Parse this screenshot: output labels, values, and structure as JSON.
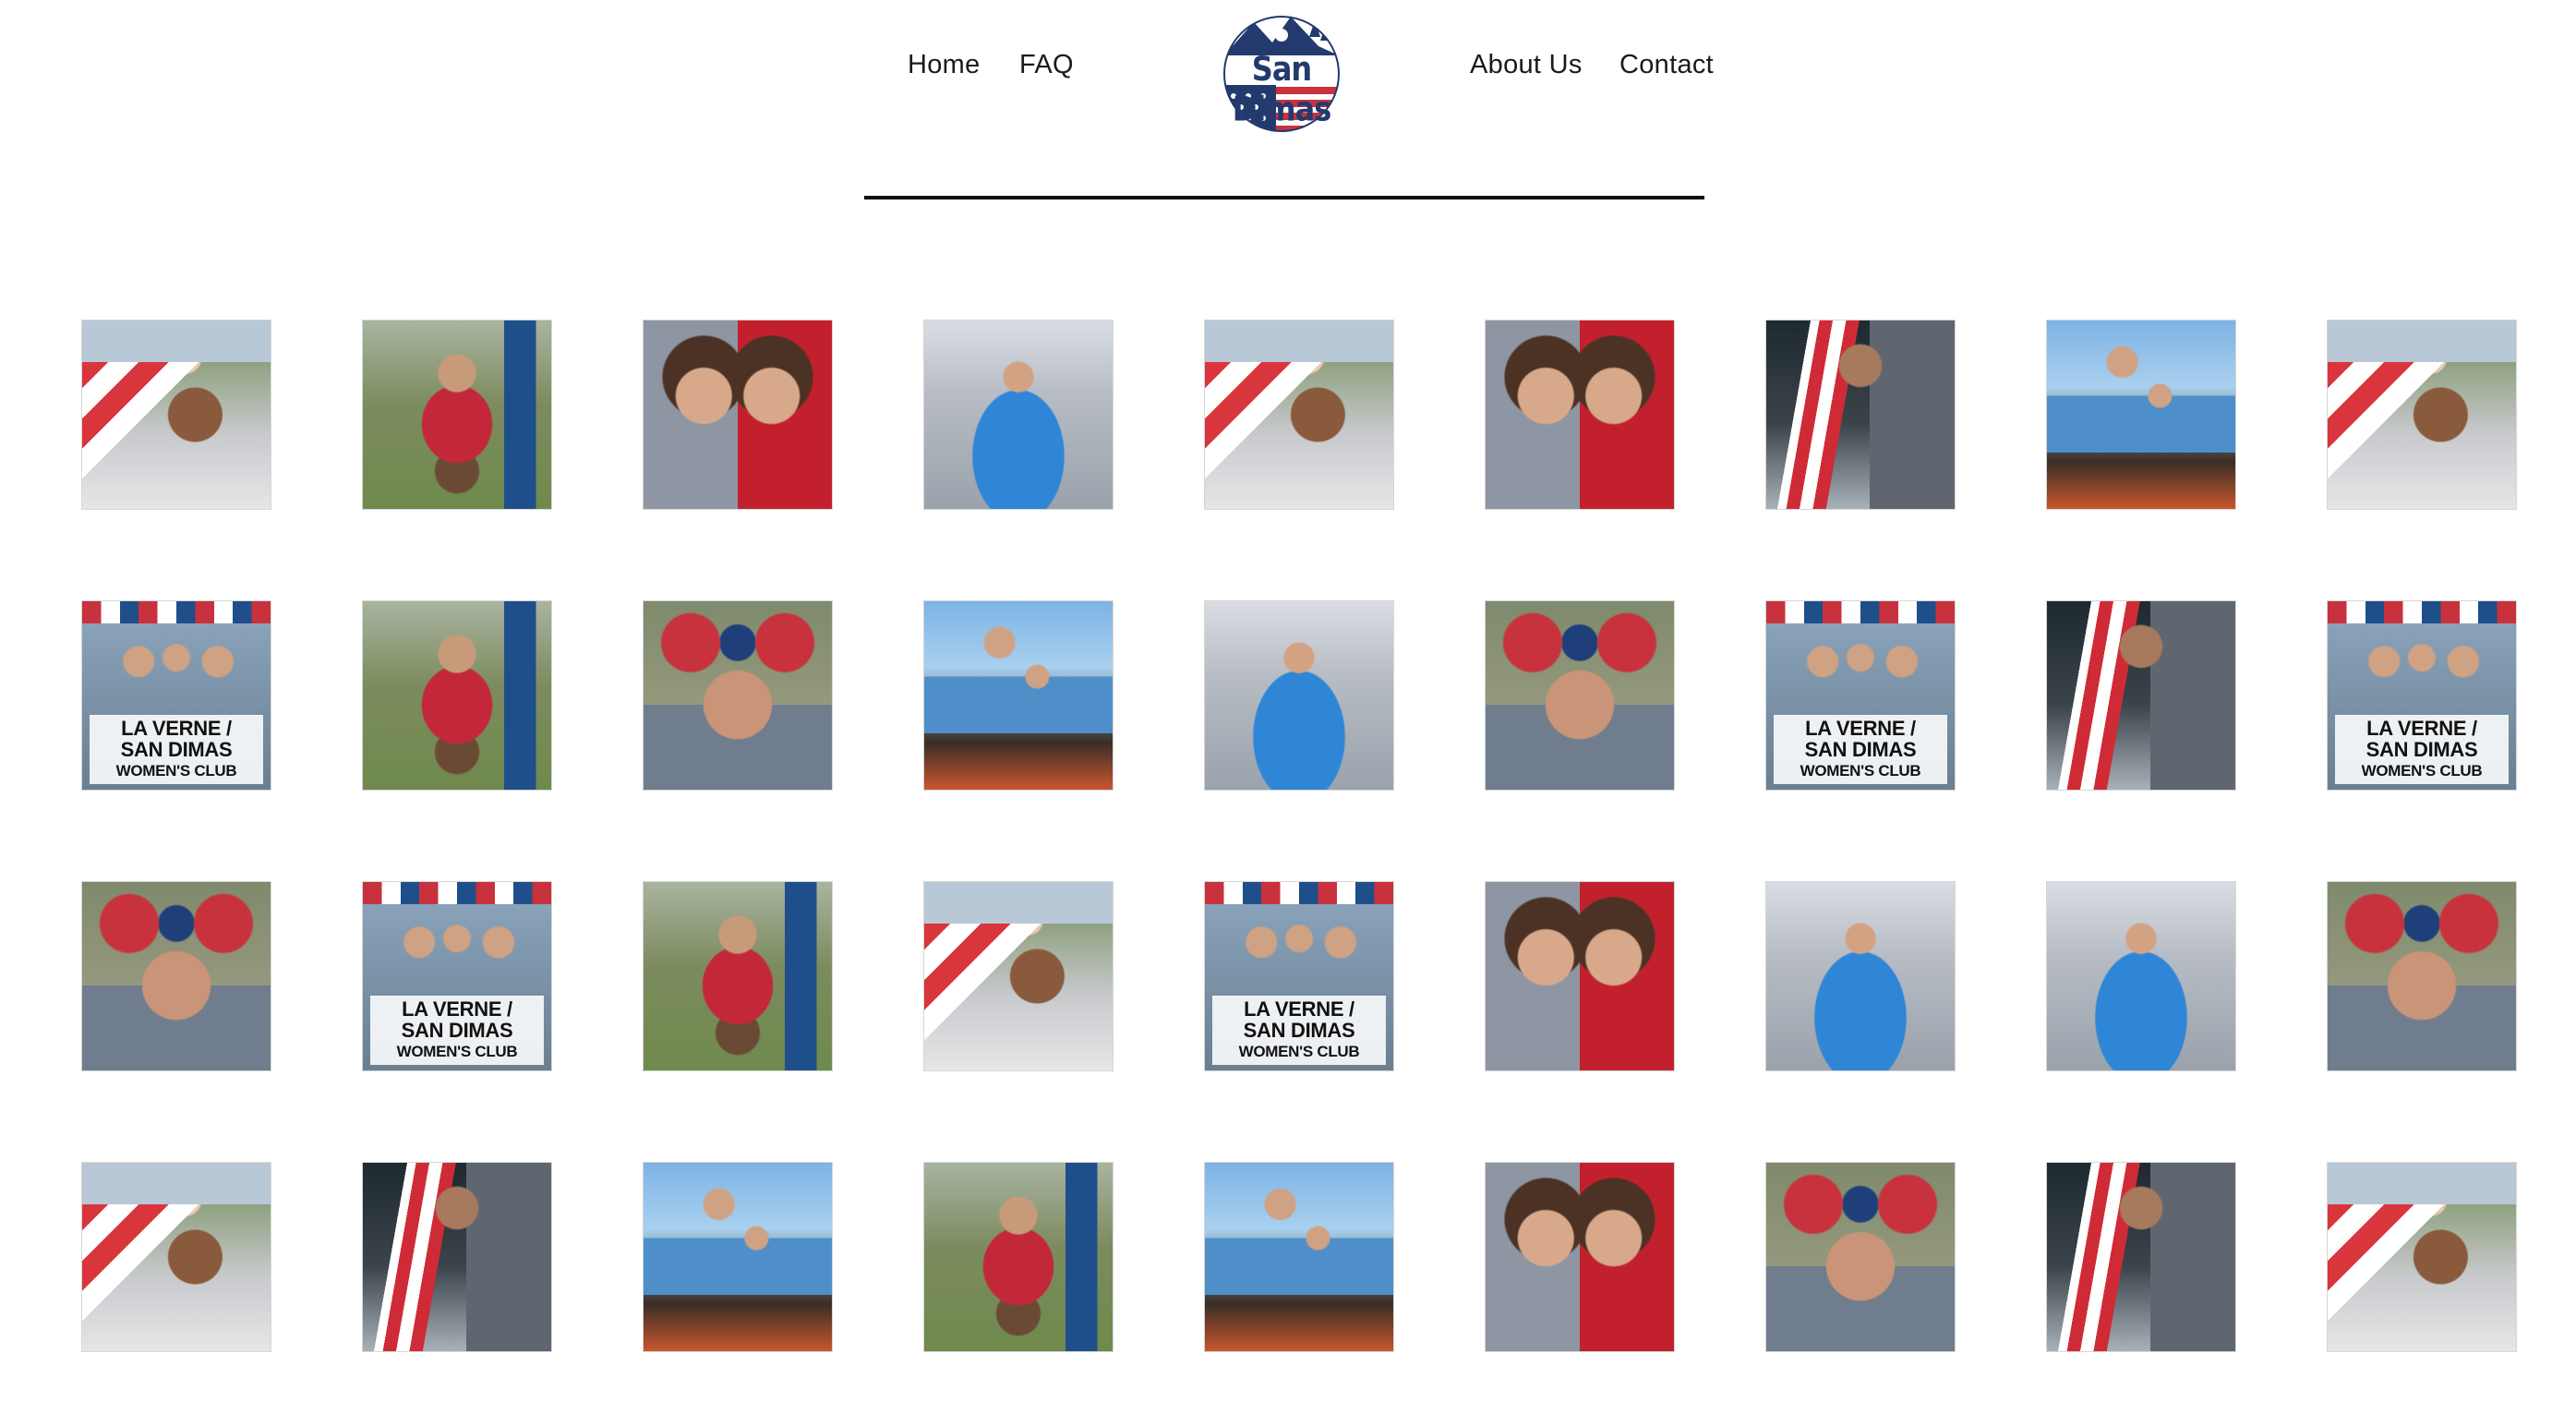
{
  "nav": {
    "home": "Home",
    "faq": "FAQ",
    "about": "About Us",
    "contact": "Contact"
  },
  "logo": {
    "text": "San Dimas",
    "colors": {
      "navy": "#233a6e",
      "red": "#c8323c"
    }
  },
  "gallery": {
    "photos": [
      {
        "kind": "man-flag-boy"
      },
      {
        "kind": "man-dog-chair"
      },
      {
        "kind": "two-girls"
      },
      {
        "kind": "boy-blue-car"
      },
      {
        "kind": "man-flag-boy"
      },
      {
        "kind": "two-girls"
      },
      {
        "kind": "man-uncle-sam-hat"
      },
      {
        "kind": "girls-parade-float"
      },
      {
        "kind": "man-flag-boy"
      },
      {
        "kind": "womens-club-banner",
        "caption_lines": [
          "LA VERNE /",
          "SAN DIMAS",
          "WOMEN'S CLUB"
        ]
      },
      {
        "kind": "man-dog-chair"
      },
      {
        "kind": "woman-minnie-ears"
      },
      {
        "kind": "girls-parade-float"
      },
      {
        "kind": "boy-blue-car"
      },
      {
        "kind": "woman-minnie-ears"
      },
      {
        "kind": "womens-club-banner",
        "caption_lines": [
          "LA VERNE /",
          "SAN DIMAS",
          "WOMEN'S CLUB"
        ]
      },
      {
        "kind": "man-uncle-sam-hat"
      },
      {
        "kind": "womens-club-banner",
        "caption_lines": [
          "LA VERNE /",
          "SAN DIMAS",
          "WOMEN'S CLUB"
        ]
      },
      {
        "kind": "woman-minnie-ears"
      },
      {
        "kind": "womens-club-banner",
        "caption_lines": [
          "LA VERNE /",
          "SAN DIMAS",
          "WOMEN'S CLUB"
        ]
      },
      {
        "kind": "man-dog-chair"
      },
      {
        "kind": "man-flag-boy"
      },
      {
        "kind": "womens-club-banner",
        "caption_lines": [
          "LA VERNE /",
          "SAN DIMAS",
          "WOMEN'S CLUB"
        ]
      },
      {
        "kind": "two-girls"
      },
      {
        "kind": "boy-blue-car"
      },
      {
        "kind": "boy-blue-car"
      },
      {
        "kind": "woman-minnie-ears"
      },
      {
        "kind": "man-flag-boy"
      },
      {
        "kind": "man-uncle-sam-hat"
      },
      {
        "kind": "girls-parade-float"
      },
      {
        "kind": "man-dog-chair"
      },
      {
        "kind": "girls-parade-float"
      },
      {
        "kind": "two-girls"
      },
      {
        "kind": "woman-minnie-ears"
      },
      {
        "kind": "man-uncle-sam-hat"
      },
      {
        "kind": "man-flag-boy"
      }
    ]
  }
}
